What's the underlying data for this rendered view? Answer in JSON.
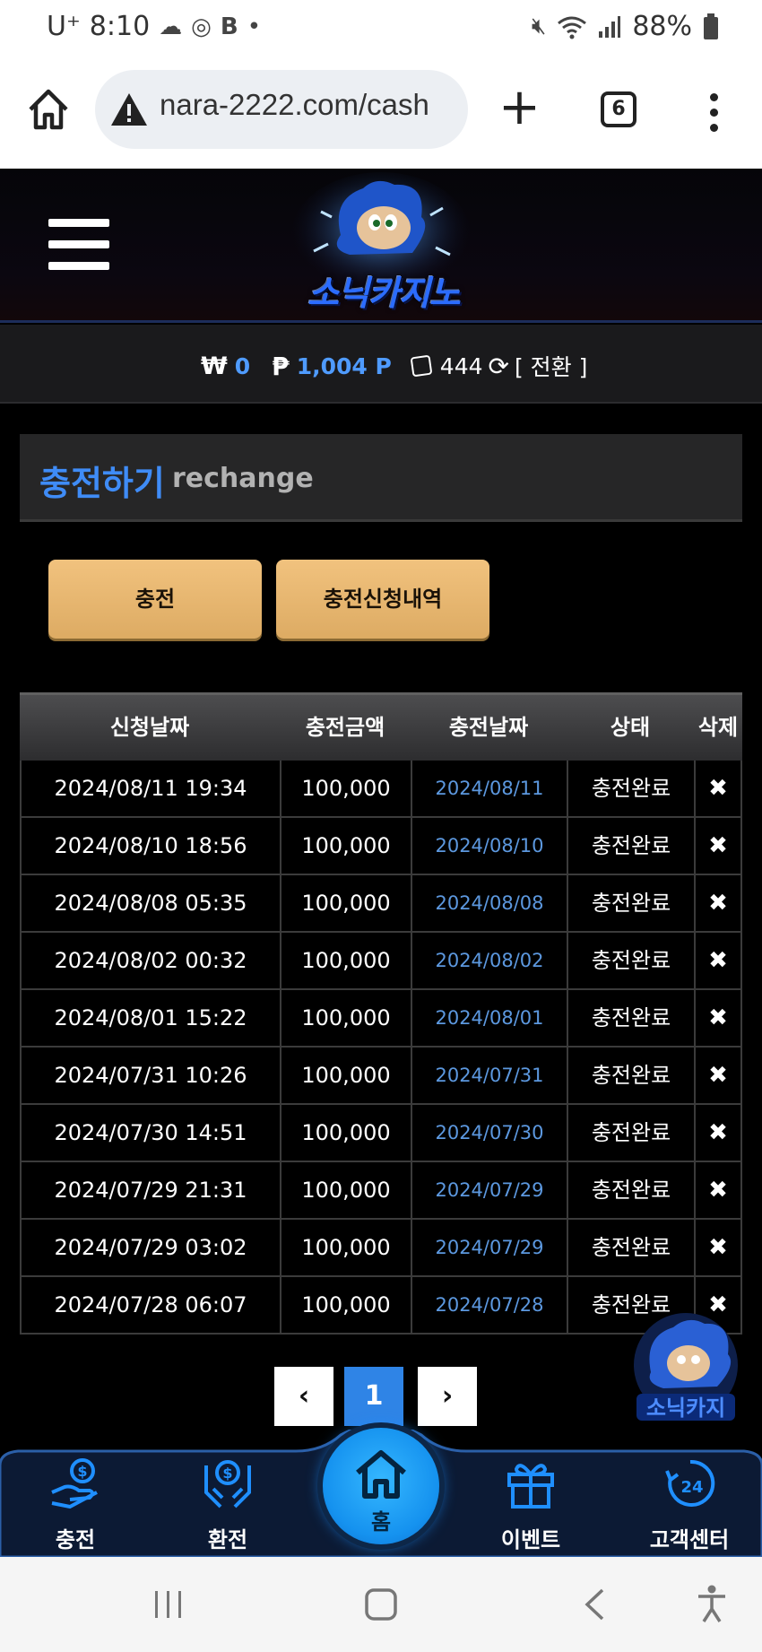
{
  "status_bar": {
    "carrier": "U⁺",
    "time": "8:10",
    "battery": "88%",
    "icons": [
      "cloud-icon",
      "sync-icon",
      "b-app-icon",
      "dot-icon",
      "mute-icon",
      "wifi-icon",
      "signal-icon",
      "battery-icon"
    ]
  },
  "browser": {
    "url": "nara-2222.com/cash",
    "tab_count": "6"
  },
  "site": {
    "logo_text": "소닉카지노"
  },
  "balance": {
    "cash": "0",
    "points": "1,004 P",
    "dice_count": "444",
    "switch_label": "[ 전환 ]"
  },
  "section": {
    "title_ko": "충전하기",
    "title_en": "rechange"
  },
  "buttons": {
    "charge": "충전",
    "history": "충전신청내역"
  },
  "table": {
    "headers": [
      "신청날짜",
      "충전금액",
      "충전날짜",
      "상태",
      "삭제"
    ],
    "rows": [
      {
        "request_date": "2024/08/11 19:34",
        "amount": "100,000",
        "charge_date": "2024/08/11",
        "status": "충전완료",
        "delete": "✖"
      },
      {
        "request_date": "2024/08/10 18:56",
        "amount": "100,000",
        "charge_date": "2024/08/10",
        "status": "충전완료",
        "delete": "✖"
      },
      {
        "request_date": "2024/08/08 05:35",
        "amount": "100,000",
        "charge_date": "2024/08/08",
        "status": "충전완료",
        "delete": "✖"
      },
      {
        "request_date": "2024/08/02 00:32",
        "amount": "100,000",
        "charge_date": "2024/08/02",
        "status": "충전완료",
        "delete": "✖"
      },
      {
        "request_date": "2024/08/01 15:22",
        "amount": "100,000",
        "charge_date": "2024/08/01",
        "status": "충전완료",
        "delete": "✖"
      },
      {
        "request_date": "2024/07/31 10:26",
        "amount": "100,000",
        "charge_date": "2024/07/31",
        "status": "충전완료",
        "delete": "✖"
      },
      {
        "request_date": "2024/07/30 14:51",
        "amount": "100,000",
        "charge_date": "2024/07/30",
        "status": "충전완료",
        "delete": "✖"
      },
      {
        "request_date": "2024/07/29 21:31",
        "amount": "100,000",
        "charge_date": "2024/07/29",
        "status": "충전완료",
        "delete": "✖"
      },
      {
        "request_date": "2024/07/29 03:02",
        "amount": "100,000",
        "charge_date": "2024/07/29",
        "status": "충전완료",
        "delete": "✖"
      },
      {
        "request_date": "2024/07/28 06:07",
        "amount": "100,000",
        "charge_date": "2024/07/28",
        "status": "충전완료",
        "delete": "✖"
      }
    ]
  },
  "pagination": {
    "prev": "‹",
    "current": "1",
    "next": "›"
  },
  "bottom_nav": {
    "charge": "충전",
    "exchange": "환전",
    "home": "홈",
    "event": "이벤트",
    "support": "고객센터"
  },
  "colors": {
    "accent_blue": "#3f8cf7",
    "button_gold": "#e8b86f",
    "home_blue": "#1592ef"
  }
}
